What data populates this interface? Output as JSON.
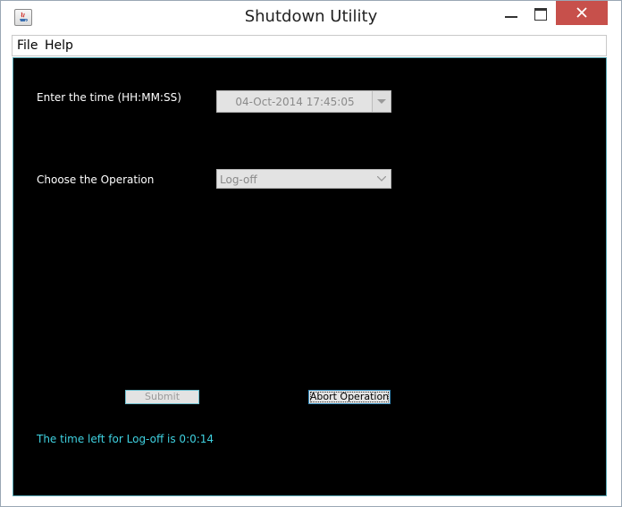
{
  "window": {
    "title": "Shutdown Utility",
    "icon": "java-icon"
  },
  "menu": {
    "file": "File",
    "help": "Help"
  },
  "form": {
    "time_label": "Enter the time (HH:MM:SS)",
    "time_value": "04-Oct-2014 17:45:05",
    "operation_label": "Choose the Operation",
    "operation_value": "Log-off"
  },
  "buttons": {
    "submit": "Submit",
    "abort": "Abort Operation"
  },
  "status": {
    "message": "The time left for Log-off is 0:0:14"
  },
  "colors": {
    "content_bg": "#000000",
    "status_text": "#3fd1e0",
    "close_button": "#c7504b"
  }
}
